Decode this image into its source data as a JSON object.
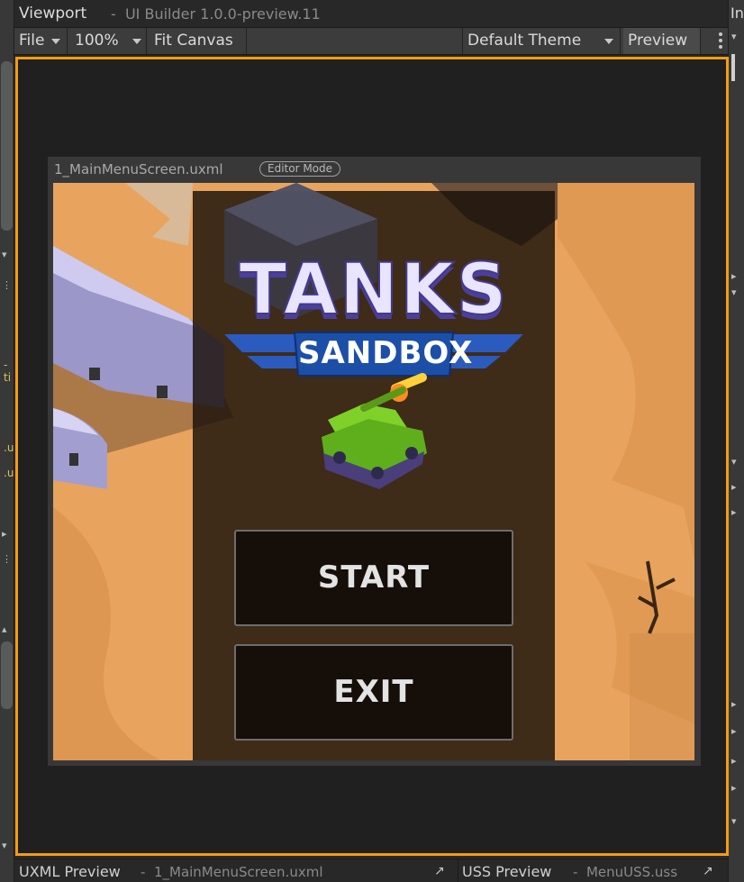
{
  "window": {
    "title": "Viewport",
    "subtitle": "UI Builder 1.0.0-preview.11"
  },
  "toolbar": {
    "file_label": "File",
    "zoom_label": "100%",
    "fit_canvas_label": "Fit Canvas",
    "theme_label": "Default Theme",
    "preview_label": "Preview"
  },
  "canvas": {
    "file_name": "1_MainMenuScreen.uxml",
    "mode_badge": "Editor Mode"
  },
  "game_menu": {
    "logo_title": "TANKS",
    "logo_subtitle": "SANDBOX",
    "start_label": "START",
    "exit_label": "EXIT"
  },
  "bottom_panels": {
    "uxml_label": "UXML Preview",
    "uxml_file": "1_MainMenuScreen.uxml",
    "uss_label": "USS Preview",
    "uss_file": "MenuUSS.uss"
  },
  "side_fragments": {
    "left_texts": [
      "-ti",
      ".u",
      ".u"
    ],
    "right_title": "In"
  },
  "colors": {
    "viewport_border": "#f39c12",
    "sand": "#e8a45e",
    "menu_overlay": "#1c140b",
    "button_bg": "#150e09",
    "logo_text": "#e9e4ff",
    "logo_outline": "#433a8e",
    "banner_blue": "#1c4fa8",
    "tank_green": "#6fbe1f"
  }
}
